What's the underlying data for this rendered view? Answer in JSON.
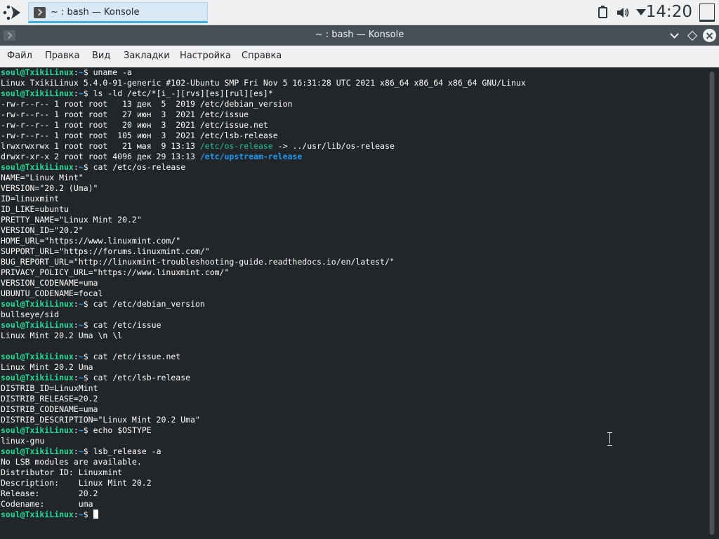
{
  "panel": {
    "task_title": "~ : bash — Konsole",
    "clock": "14:20",
    "icons": [
      "launcher-icon",
      "clipboard-icon",
      "volume-icon",
      "menu-arrow-icon",
      "show-desktop-icon"
    ]
  },
  "window": {
    "title": "~ : bash — Konsole"
  },
  "menu": {
    "file": "Файл",
    "edit": "Правка",
    "view": "Вид",
    "bookmarks": "Закладки",
    "settings": "Настройка",
    "help": "Справка"
  },
  "colors": {
    "prompt_user": "#1cdc9a",
    "prompt_path": "#1d99f3",
    "symlink": "#1abc9c",
    "directory": "#1d99f3",
    "background": "#232629",
    "foreground": "#fcfcfc"
  },
  "prompt": {
    "user_host": "soul@TxikiLinux",
    "sep": ":",
    "path": "~",
    "sigil": "$ "
  },
  "terminal": {
    "lines": [
      {
        "type": "prompt",
        "cmd": "uname -a"
      },
      {
        "type": "out",
        "text": "Linux TxikiLinux 5.4.0-91-generic #102-Ubuntu SMP Fri Nov 5 16:31:28 UTC 2021 x86_64 x86_64 x86_64 GNU/Linux"
      },
      {
        "type": "prompt",
        "cmd": "ls -ld /etc/*[i_-][rvs][es][rul][es]*"
      },
      {
        "type": "out",
        "text": "-rw-r--r-- 1 root root   13 дек  5  2019 /etc/debian_version"
      },
      {
        "type": "out",
        "text": "-rw-r--r-- 1 root root   27 июн  3  2021 /etc/issue"
      },
      {
        "type": "out",
        "text": "-rw-r--r-- 1 root root   20 июн  3  2021 /etc/issue.net"
      },
      {
        "type": "out",
        "text": "-rw-r--r-- 1 root root  105 июн  3  2021 /etc/lsb-release"
      },
      {
        "type": "link",
        "pre": "lrwxrwxrwx 1 root root   21 мая  9 13:13 ",
        "name": "/etc/os-release",
        "post": " -> ../usr/lib/os-release"
      },
      {
        "type": "dir",
        "pre": "drwxr-xr-x 2 root root 4096 дек 29 13:13 ",
        "name": "/etc/upstream-release"
      },
      {
        "type": "prompt",
        "cmd": "cat /etc/os-release"
      },
      {
        "type": "out",
        "text": "NAME=\"Linux Mint\""
      },
      {
        "type": "out",
        "text": "VERSION=\"20.2 (Uma)\""
      },
      {
        "type": "out",
        "text": "ID=linuxmint"
      },
      {
        "type": "out",
        "text": "ID_LIKE=ubuntu"
      },
      {
        "type": "out",
        "text": "PRETTY_NAME=\"Linux Mint 20.2\""
      },
      {
        "type": "out",
        "text": "VERSION_ID=\"20.2\""
      },
      {
        "type": "out",
        "text": "HOME_URL=\"https://www.linuxmint.com/\""
      },
      {
        "type": "out",
        "text": "SUPPORT_URL=\"https://forums.linuxmint.com/\""
      },
      {
        "type": "out",
        "text": "BUG_REPORT_URL=\"http://linuxmint-troubleshooting-guide.readthedocs.io/en/latest/\""
      },
      {
        "type": "out",
        "text": "PRIVACY_POLICY_URL=\"https://www.linuxmint.com/\""
      },
      {
        "type": "out",
        "text": "VERSION_CODENAME=uma"
      },
      {
        "type": "out",
        "text": "UBUNTU_CODENAME=focal"
      },
      {
        "type": "prompt",
        "cmd": "cat /etc/debian_version"
      },
      {
        "type": "out",
        "text": "bullseye/sid"
      },
      {
        "type": "prompt",
        "cmd": "cat /etc/issue"
      },
      {
        "type": "out",
        "text": "Linux Mint 20.2 Uma \\n \\l"
      },
      {
        "type": "out",
        "text": ""
      },
      {
        "type": "prompt",
        "cmd": "cat /etc/issue.net"
      },
      {
        "type": "out",
        "text": "Linux Mint 20.2 Uma"
      },
      {
        "type": "prompt",
        "cmd": "cat /etc/lsb-release"
      },
      {
        "type": "out",
        "text": "DISTRIB_ID=LinuxMint"
      },
      {
        "type": "out",
        "text": "DISTRIB_RELEASE=20.2"
      },
      {
        "type": "out",
        "text": "DISTRIB_CODENAME=uma"
      },
      {
        "type": "out",
        "text": "DISTRIB_DESCRIPTION=\"Linux Mint 20.2 Uma\""
      },
      {
        "type": "prompt",
        "cmd": "echo $OSTYPE"
      },
      {
        "type": "out",
        "text": "linux-gnu"
      },
      {
        "type": "prompt",
        "cmd": "lsb_release -a"
      },
      {
        "type": "out",
        "text": "No LSB modules are available."
      },
      {
        "type": "out",
        "text": "Distributor ID:\tLinuxmint"
      },
      {
        "type": "out",
        "text": "Description:\tLinux Mint 20.2"
      },
      {
        "type": "out",
        "text": "Release:\t20.2"
      },
      {
        "type": "out",
        "text": "Codename:\tuma"
      },
      {
        "type": "prompt",
        "cmd": "",
        "cursor": true
      }
    ]
  }
}
